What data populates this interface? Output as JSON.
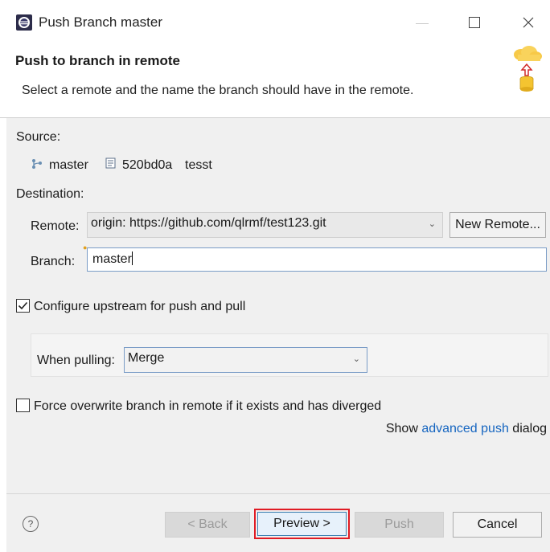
{
  "window": {
    "title": "Push Branch master"
  },
  "header": {
    "title": "Push to branch in remote",
    "description": "Select a remote and the name the branch should have in the remote."
  },
  "source": {
    "label": "Source:",
    "branch": "master",
    "commit_id": "520bd0a",
    "commit_message": "tesst"
  },
  "destination": {
    "label": "Destination:",
    "remote_label": "Remote:",
    "remote_value": "origin: https://github.com/qlrmf/test123.git",
    "new_remote_button": "New Remote...",
    "branch_label": "Branch:",
    "branch_value": "master"
  },
  "upstream": {
    "label": "Configure upstream for push and pull",
    "checked": true,
    "pulling_label": "When pulling:",
    "pulling_value": "Merge"
  },
  "force": {
    "label": "Force overwrite branch in remote if it exists and has diverged",
    "checked": false
  },
  "advanced": {
    "prefix": "Show ",
    "link": "advanced push",
    "suffix": " dialog"
  },
  "footer": {
    "help": "?",
    "back": "< Back",
    "preview": "Preview >",
    "push": "Push",
    "cancel": "Cancel"
  },
  "colors": {
    "link": "#1565c0",
    "highlight_border": "#e01b24",
    "focus_border": "#3c7fb1"
  }
}
